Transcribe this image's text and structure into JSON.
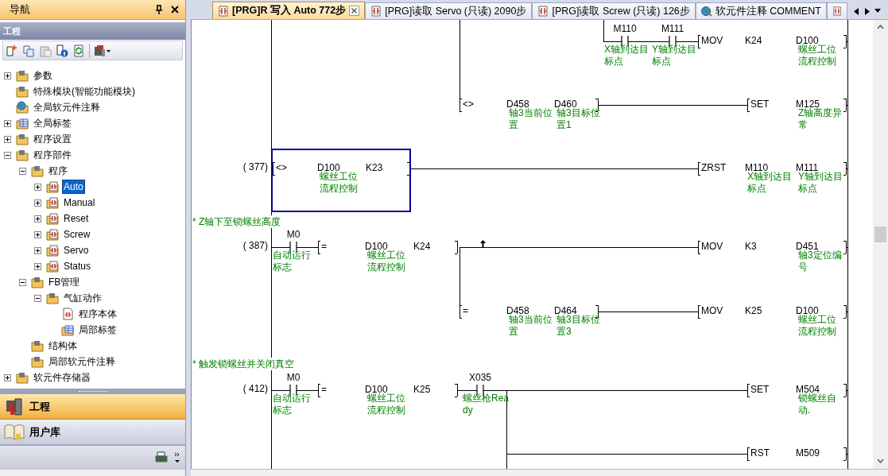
{
  "nav": {
    "title": "导航",
    "section": "工程",
    "tree": [
      {
        "label": "参数",
        "kind": "folder",
        "expanded": false,
        "selected": false
      },
      {
        "label": "特殊模块(智能功能模块)",
        "kind": "folder",
        "selected": false
      },
      {
        "label": "全局软元件注释",
        "kind": "globe",
        "selected": false
      },
      {
        "label": "全局标签",
        "kind": "table",
        "expanded": false,
        "selected": false
      },
      {
        "label": "程序设置",
        "kind": "folder",
        "expanded": false,
        "selected": false
      },
      {
        "label": "程序部件",
        "kind": "folder",
        "expanded": true,
        "selected": false,
        "children": [
          {
            "label": "程序",
            "kind": "folder",
            "expanded": true,
            "selected": false,
            "children": [
              {
                "label": "Auto",
                "kind": "program",
                "expanded": false,
                "selected": true
              },
              {
                "label": "Manual",
                "kind": "program",
                "expanded": false,
                "selected": false
              },
              {
                "label": "Reset",
                "kind": "program",
                "expanded": false,
                "selected": false
              },
              {
                "label": "Screw",
                "kind": "program",
                "expanded": false,
                "selected": false
              },
              {
                "label": "Servo",
                "kind": "program",
                "expanded": false,
                "selected": false
              },
              {
                "label": "Status",
                "kind": "program",
                "expanded": false,
                "selected": false
              }
            ]
          },
          {
            "label": "FB管理",
            "kind": "folder",
            "expanded": true,
            "selected": false,
            "children": [
              {
                "label": "气缸动作",
                "kind": "folder",
                "expanded": true,
                "selected": false,
                "children": [
                  {
                    "label": "程序本体",
                    "kind": "page",
                    "selected": false
                  },
                  {
                    "label": "局部标签",
                    "kind": "table",
                    "selected": false
                  }
                ]
              }
            ]
          },
          {
            "label": "结构体",
            "kind": "folder",
            "selected": false
          },
          {
            "label": "局部软元件注释",
            "kind": "folder",
            "selected": false
          }
        ]
      },
      {
        "label": "软元件存储器",
        "kind": "folder",
        "expanded": false,
        "selected": false
      }
    ],
    "bottom_tabs": [
      {
        "label": "工程",
        "selected": true
      },
      {
        "label": "用户库",
        "selected": false
      }
    ]
  },
  "tabs": [
    {
      "label": "[PRG]R 写入 Auto 772步",
      "kind": "program",
      "selected": true
    },
    {
      "label": "[PRG]读取 Servo (只读) 2090步",
      "kind": "program",
      "selected": false
    },
    {
      "label": "[PRG]读取 Screw (只读) 126步",
      "kind": "program",
      "selected": false
    },
    {
      "label": "软元件注释 COMMENT",
      "kind": "comment",
      "selected": false
    },
    {
      "kind": "program",
      "selected": false
    }
  ],
  "ladder": [
    {
      "kind": "contact",
      "device": "M110",
      "comment": "X轴到达目标点",
      "selected": false
    },
    {
      "kind": "contact",
      "device": "M111",
      "comment": "Y轴到达目标点",
      "selected": false
    },
    {
      "kind": "instruction",
      "op": "MOV",
      "operands": [
        {
          "device": "K24"
        },
        {
          "device": "D100",
          "comment": "螺丝工位流程控制"
        }
      ],
      "selected": false
    },
    {
      "kind": "instruction",
      "op": "<>",
      "operands": [
        {
          "device": "D458",
          "comment": "轴3当前位置"
        },
        {
          "device": "D460",
          "comment": "轴3目标位置1"
        }
      ],
      "selected": false
    },
    {
      "kind": "instruction",
      "op": "SET",
      "operands": [
        {
          "device": "M125",
          "comment": "Z轴高度异常"
        }
      ],
      "selected": false
    },
    {
      "kind": "step",
      "text": "( 377)"
    },
    {
      "kind": "instruction",
      "op": "<>",
      "operands": [
        {
          "device": "D100",
          "comment": "螺丝工位流程控制"
        },
        {
          "device": "K23"
        }
      ],
      "selected": true
    },
    {
      "kind": "instruction",
      "op": "ZRST",
      "operands": [
        {
          "device": "M110",
          "comment": "X轴到达目标点"
        },
        {
          "device": "M111",
          "comment": "Y轴到达目标点"
        }
      ],
      "selected": false
    },
    {
      "kind": "comment",
      "text": "* Z轴下至锁螺丝高度"
    },
    {
      "kind": "step",
      "text": "( 387)"
    },
    {
      "kind": "contact",
      "device": "M0",
      "comment": "自动运行标志",
      "selected": false
    },
    {
      "kind": "instruction",
      "op": "=",
      "operands": [
        {
          "device": "D100",
          "comment": "螺丝工位流程控制"
        },
        {
          "device": "K24"
        }
      ],
      "selected": false
    },
    {
      "kind": "instruction",
      "op": "MOV",
      "operands": [
        {
          "device": "K3"
        },
        {
          "device": "D451",
          "comment": "轴3定位编号"
        }
      ],
      "selected": false
    },
    {
      "kind": "instruction",
      "op": "=",
      "operands": [
        {
          "device": "D458",
          "comment": "轴3当前位置"
        },
        {
          "device": "D464",
          "comment": "轴3目标位置3"
        }
      ],
      "selected": false
    },
    {
      "kind": "instruction",
      "op": "MOV",
      "operands": [
        {
          "device": "K25"
        },
        {
          "device": "D100",
          "comment": "螺丝工位流程控制"
        }
      ],
      "selected": false
    },
    {
      "kind": "comment",
      "text": "* 触发锁螺丝并关闭真空"
    },
    {
      "kind": "step",
      "text": "( 412)"
    },
    {
      "kind": "contact",
      "device": "M0",
      "comment": "自动运行标志",
      "selected": false
    },
    {
      "kind": "instruction",
      "op": "=",
      "operands": [
        {
          "device": "D100",
          "comment": "螺丝工位流程控制"
        },
        {
          "device": "K25"
        }
      ],
      "selected": false
    },
    {
      "kind": "contact",
      "device": "X035",
      "comment": "螺丝枪Ready",
      "selected": false
    },
    {
      "kind": "instruction",
      "op": "SET",
      "operands": [
        {
          "device": "M504",
          "comment": "锁螺丝自动."
        }
      ],
      "selected": false
    },
    {
      "kind": "instruction",
      "op": "RST",
      "operands": [
        {
          "device": "M509"
        }
      ],
      "selected": false
    }
  ]
}
